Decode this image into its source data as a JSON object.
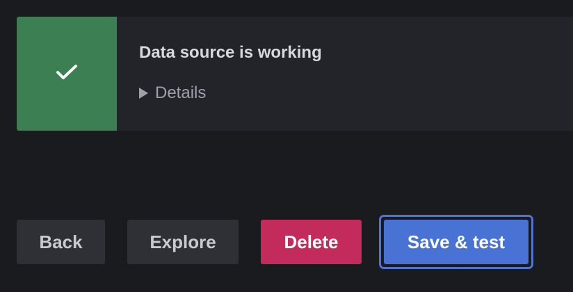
{
  "alert": {
    "icon": "check-icon",
    "title": "Data source is working",
    "details_label": "Details",
    "status_color": "#3b7f52"
  },
  "actions": {
    "back_label": "Back",
    "explore_label": "Explore",
    "delete_label": "Delete",
    "save_test_label": "Save & test"
  },
  "colors": {
    "background": "#1a1b1f",
    "panel": "#232429",
    "secondary_button": "#2f3036",
    "danger": "#c22b5c",
    "primary": "#4873d4"
  }
}
